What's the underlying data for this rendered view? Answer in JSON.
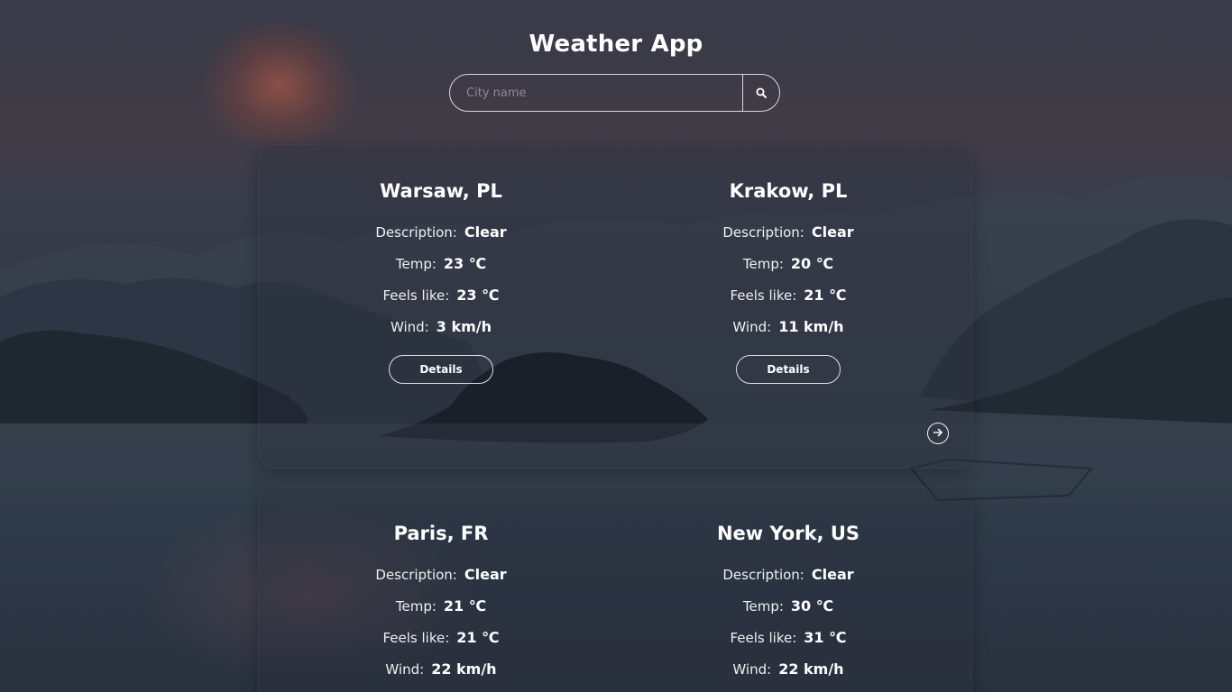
{
  "app": {
    "title": "Weather App"
  },
  "search": {
    "placeholder": "City name",
    "value": ""
  },
  "labels": {
    "description": "Description:",
    "temp": "Temp:",
    "feels_like": "Feels like:",
    "wind": "Wind:",
    "details": "Details"
  },
  "cities": [
    {
      "name": "Warsaw, PL",
      "description": "Clear",
      "temp": "23 ℃",
      "feels_like": "23 ℃",
      "wind": "3 km/h"
    },
    {
      "name": "Krakow, PL",
      "description": "Clear",
      "temp": "20 ℃",
      "feels_like": "21 ℃",
      "wind": "11 km/h"
    },
    {
      "name": "Paris, FR",
      "description": "Clear",
      "temp": "21 ℃",
      "feels_like": "21 ℃",
      "wind": "22 km/h"
    },
    {
      "name": "New York, US",
      "description": "Clear",
      "temp": "30 ℃",
      "feels_like": "31 ℃",
      "wind": "22 km/h"
    }
  ],
  "icons": {
    "search": "search-icon",
    "next": "arrow-right-circle-icon"
  },
  "colors": {
    "text": "#ffffff",
    "border": "#d8d8d8"
  }
}
